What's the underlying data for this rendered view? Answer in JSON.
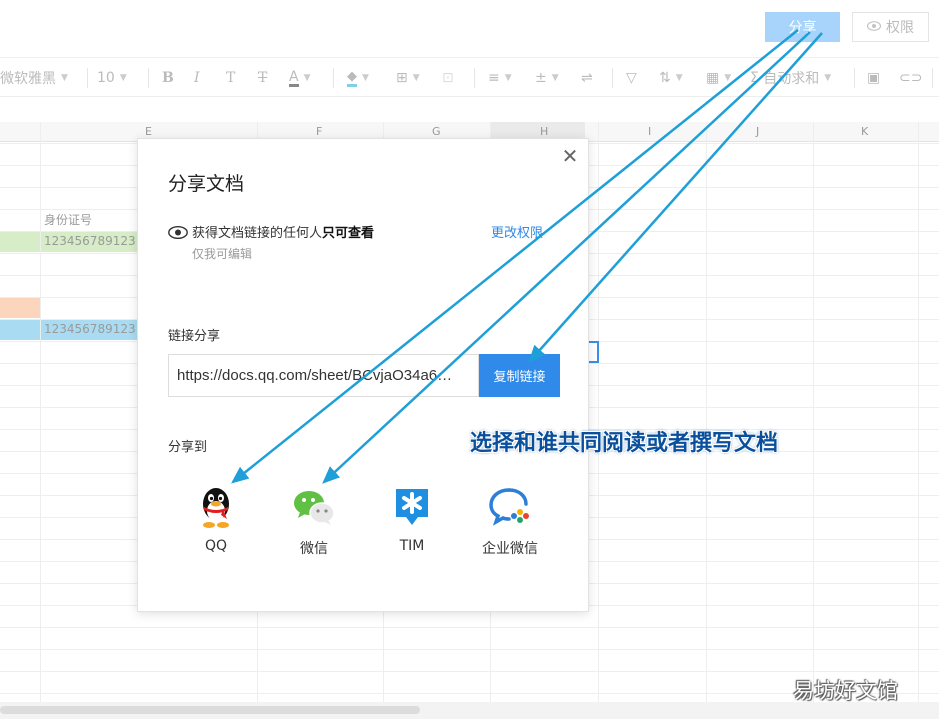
{
  "topbar": {
    "share_label": "分享",
    "permission_label": "权限"
  },
  "toolbar": {
    "font_name": "微软雅黑",
    "font_size": "10",
    "auto_sum": "自动求和"
  },
  "sheet": {
    "columns": [
      "E",
      "F",
      "G",
      "H",
      "I",
      "J",
      "K"
    ],
    "header_cell": "身份证号",
    "id_cell_1": "123456789123",
    "id_cell_2": "123456789123",
    "colors": {
      "green": "#d6edc8",
      "orange": "#fcd5bd",
      "blue": "#a9dcf2"
    }
  },
  "dialog": {
    "title": "分享文档",
    "access_prefix": "获得文档链接的任何人",
    "access_bold": "只可查看",
    "access_sub": "仅我可编辑",
    "change_permission": "更改权限",
    "link_label": "链接分享",
    "link_value": "https://docs.qq.com/sheet/BCvjaO34a6…",
    "copy_button": "复制链接",
    "share_to_label": "分享到",
    "apps": [
      {
        "label": "QQ",
        "icon": "qq-penguin-icon"
      },
      {
        "label": "微信",
        "icon": "wechat-icon"
      },
      {
        "label": "TIM",
        "icon": "tim-icon"
      },
      {
        "label": "企业微信",
        "icon": "wecom-icon"
      }
    ]
  },
  "annotation": {
    "callout": "选择和谁共同阅读或者撰写文档",
    "arrow_color": "#1e9fd8"
  },
  "watermark": "易坊好文馆"
}
